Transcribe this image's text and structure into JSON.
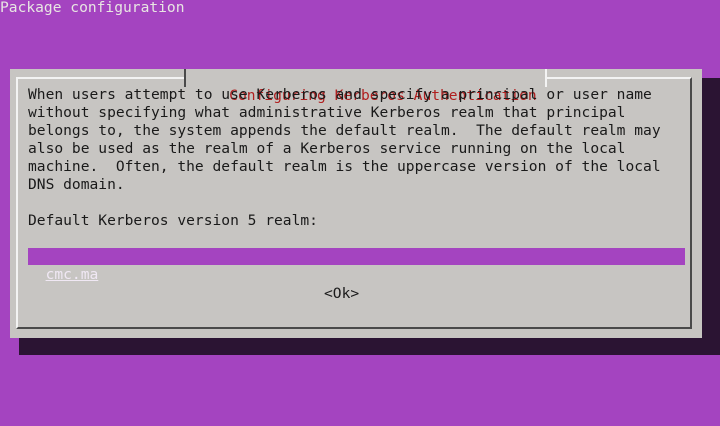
{
  "window": {
    "header": "Package configuration"
  },
  "dialog": {
    "title": "Configuring Kerberos Authentication",
    "description_lines": [
      "When users attempt to use Kerberos and specify a principal or user name",
      "without specifying what administrative Kerberos realm that principal",
      "belongs to, the system appends the default realm.  The default realm may",
      "also be used as the realm of a Kerberos service running on the local",
      "machine.  Often, the default realm is the uppercase version of the local",
      "DNS domain."
    ],
    "prompt_label": "Default Kerberos version 5 realm:",
    "input_value": "cmc.ma",
    "ok_label": "<Ok>"
  },
  "colors": {
    "background": "#a444c0",
    "dialog": "#c7c5c2",
    "title": "#b01f1f",
    "shadow": "#2b1433"
  }
}
